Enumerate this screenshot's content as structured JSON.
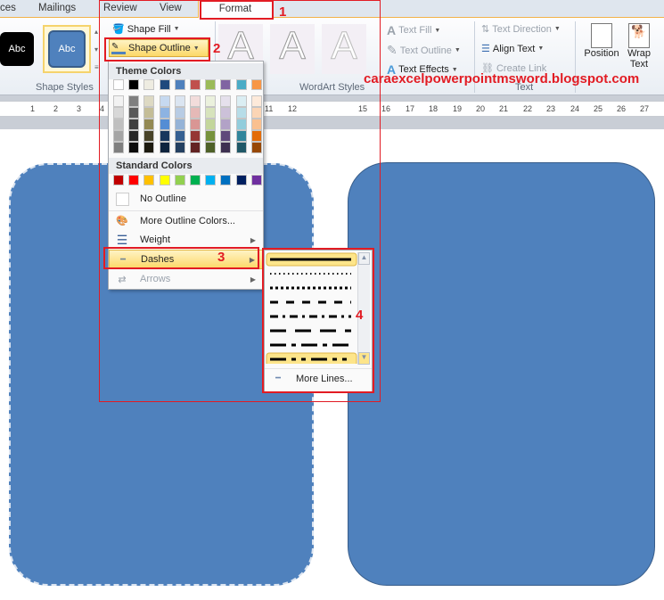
{
  "tabs": [
    "ces",
    "Mailings",
    "Review",
    "View",
    "Format"
  ],
  "ribbon": {
    "shape_style_samples": [
      "Abc",
      "Abc"
    ],
    "shape_fill": "Shape Fill",
    "shape_outline": "Shape Outline",
    "shape_styles_label": "Shape Styles",
    "wordart_label": "WordArt Styles",
    "text_fill": "Text Fill",
    "text_outline": "Text Outline",
    "text_effects": "Text Effects",
    "text_direction": "Text Direction",
    "align_text": "Align Text",
    "create_link": "Create Link",
    "text_label": "Text",
    "position": "Position",
    "wrap_text": "Wrap Text",
    "wordart_glyph": "A"
  },
  "ruler": {
    "left": [
      "1",
      "2",
      "3",
      "4"
    ],
    "right": [
      "11",
      "12",
      "15",
      "16",
      "17",
      "18",
      "19",
      "20",
      "21",
      "22",
      "23",
      "24",
      "25",
      "26",
      "27"
    ]
  },
  "watermark": "caraexcelpowerpointmsword.blogspot.com",
  "menu": {
    "theme_header": "Theme Colors",
    "theme_colors": [
      "#ffffff",
      "#000000",
      "#eeece1",
      "#1f497d",
      "#4f81bd",
      "#c0504d",
      "#9bbb59",
      "#8064a2",
      "#4bacc6",
      "#f79646"
    ],
    "theme_shades": [
      [
        "#f2f2f2",
        "#d8d8d8",
        "#bfbfbf",
        "#a5a5a5",
        "#7f7f7f"
      ],
      [
        "#7f7f7f",
        "#595959",
        "#3f3f3f",
        "#262626",
        "#0c0c0c"
      ],
      [
        "#ddd9c3",
        "#c4bd97",
        "#938953",
        "#494429",
        "#1d1b10"
      ],
      [
        "#c6d9f0",
        "#8db3e2",
        "#548dd4",
        "#17365d",
        "#0f243e"
      ],
      [
        "#dbe5f1",
        "#b8cce4",
        "#95b3d7",
        "#366092",
        "#244061"
      ],
      [
        "#f2dcdb",
        "#e5b9b7",
        "#d99694",
        "#953734",
        "#632423"
      ],
      [
        "#ebf1dd",
        "#d7e3bc",
        "#c3d69b",
        "#76923c",
        "#4f6128"
      ],
      [
        "#e5e0ec",
        "#ccc1d9",
        "#b2a2c7",
        "#5f497a",
        "#3f3151"
      ],
      [
        "#dbeef3",
        "#b7dde8",
        "#92cddc",
        "#31859b",
        "#205867"
      ],
      [
        "#fdeada",
        "#fbd5b5",
        "#fac08f",
        "#e36c09",
        "#974806"
      ]
    ],
    "standard_header": "Standard Colors",
    "standard_colors": [
      "#c00000",
      "#ff0000",
      "#ffc000",
      "#ffff00",
      "#92d050",
      "#00b050",
      "#00b0f0",
      "#0070c0",
      "#002060",
      "#7030a0"
    ],
    "items": [
      "No Outline",
      "More Outline Colors...",
      "Weight",
      "Dashes",
      "Arrows"
    ]
  },
  "submenu": {
    "more_lines": "More Lines..."
  },
  "annotations": [
    "1",
    "2",
    "3",
    "4"
  ],
  "colors": {
    "shape_fill": "#4f81bd",
    "annotation": "#e21b23",
    "highlight": "#fde58a"
  }
}
